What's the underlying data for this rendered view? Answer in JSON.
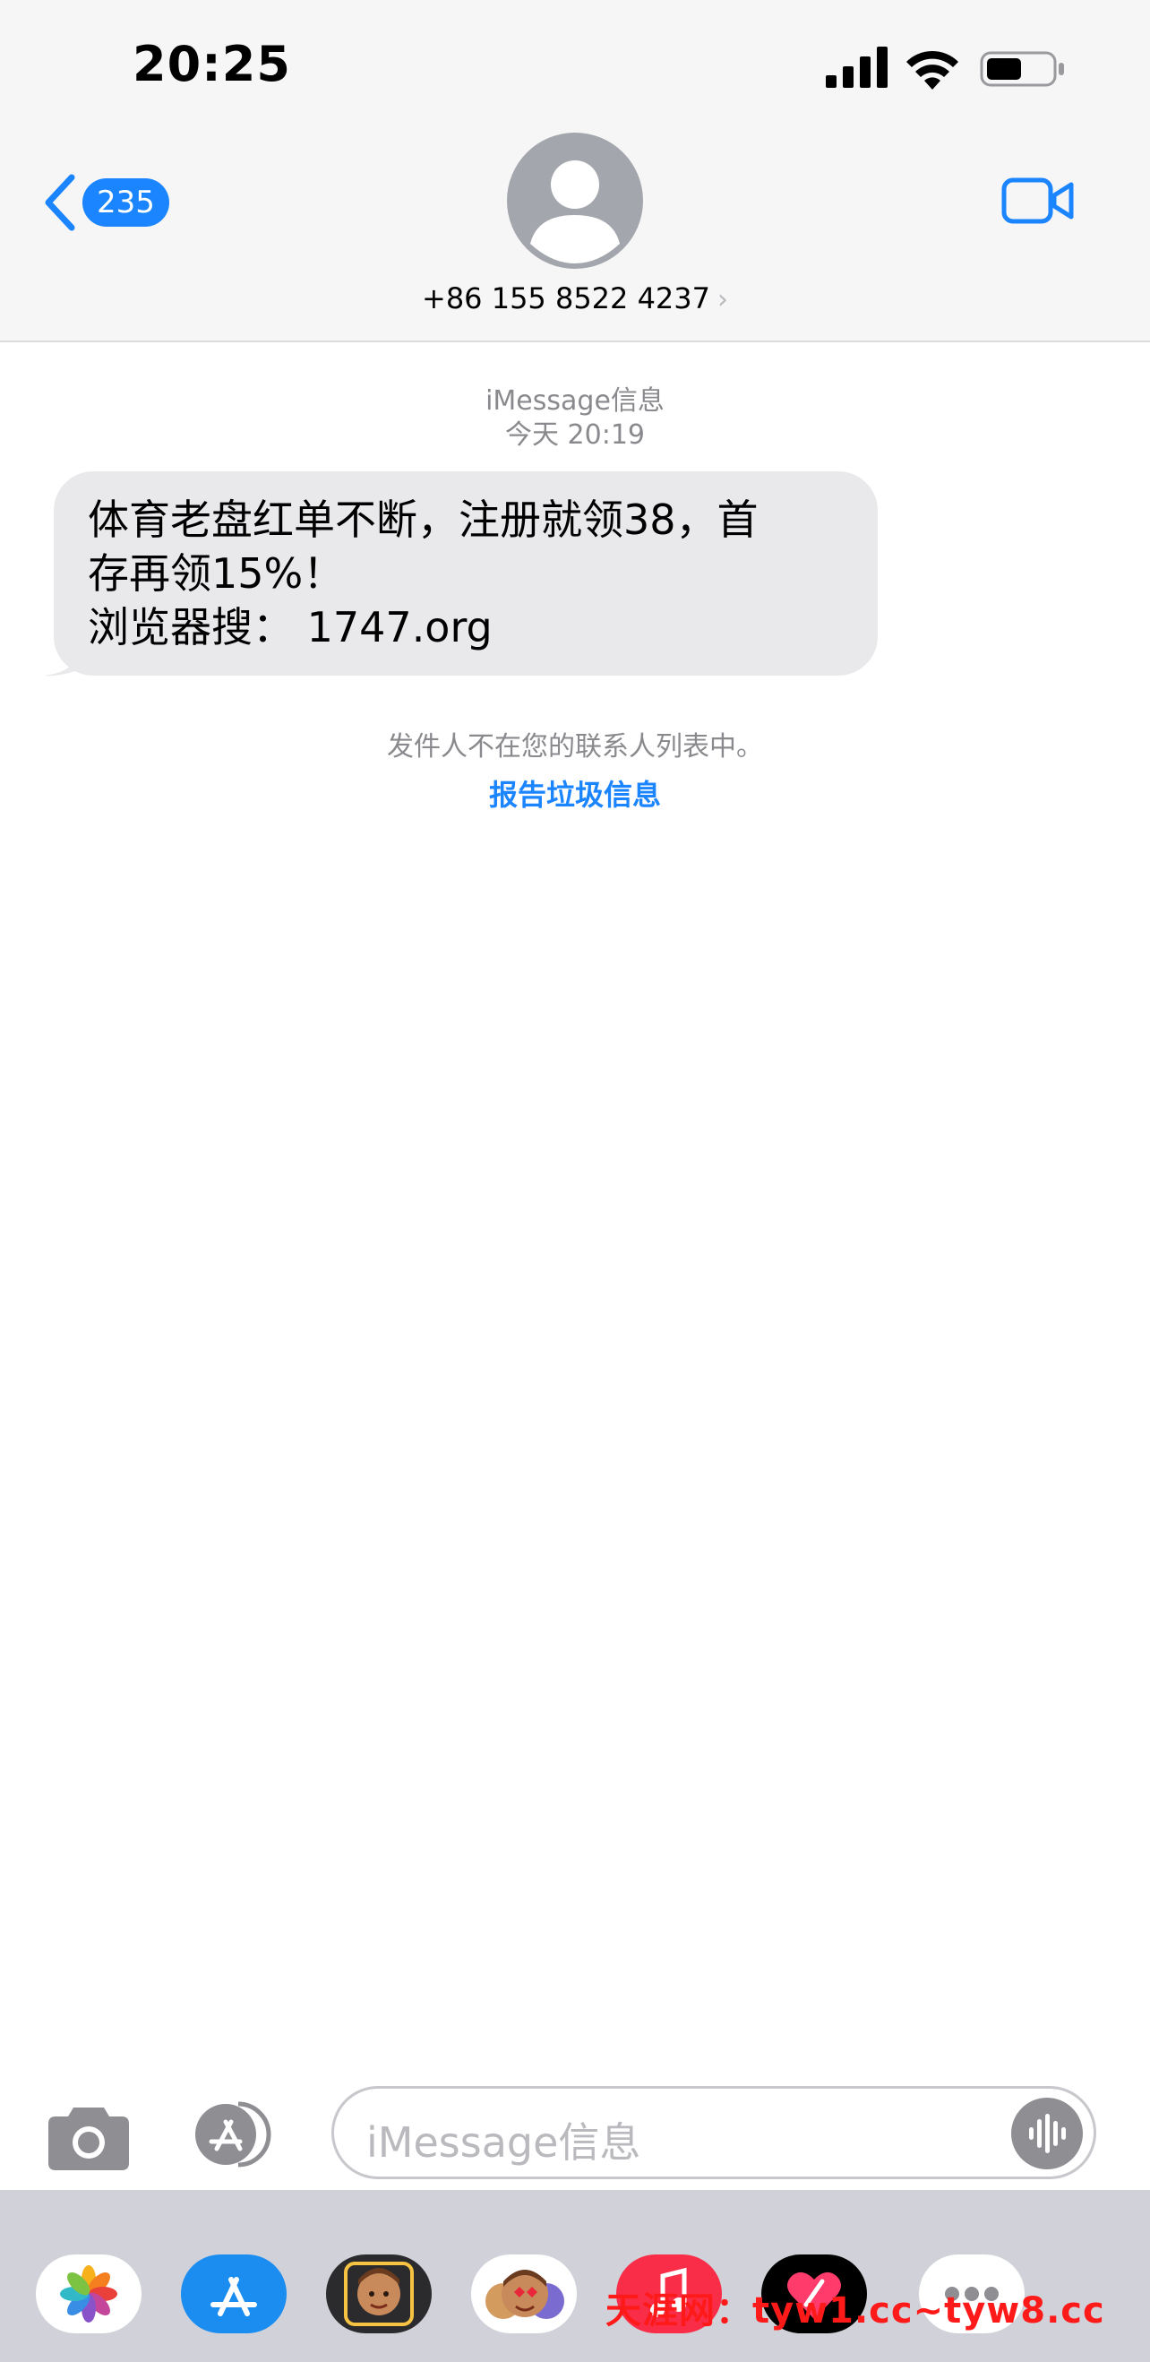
{
  "status_bar": {
    "time": "20:25"
  },
  "header": {
    "back_count": "235",
    "contact": "+86 155 8522 4237",
    "contact_chevron": "›"
  },
  "conversation": {
    "service_label": "iMessage信息",
    "timestamp": "今天 20:19",
    "message": {
      "lines": [
        "体育老盘红单不断，注册就领38，首",
        "存再领15%！",
        "浏览器搜： 1747.org"
      ]
    },
    "notice": "发件人不在您的联系人列表中。",
    "report_link": "报告垃圾信息"
  },
  "input": {
    "placeholder": "iMessage信息"
  },
  "app_drawer": {
    "apps": [
      "photos-icon",
      "app-store-icon",
      "memoji-stickers-icon",
      "animoji-icon",
      "music-icon",
      "digital-touch-icon",
      "more-apps-icon"
    ]
  },
  "watermark": "天涯网：tyw1.cc~tyw8.cc",
  "colors": {
    "accent": "#1b84ff",
    "bubble": "#e9e9eb",
    "header_bg": "#f6f6f7",
    "drawer_bg": "#d1d2d9",
    "watermark": "#ff1a1a"
  }
}
